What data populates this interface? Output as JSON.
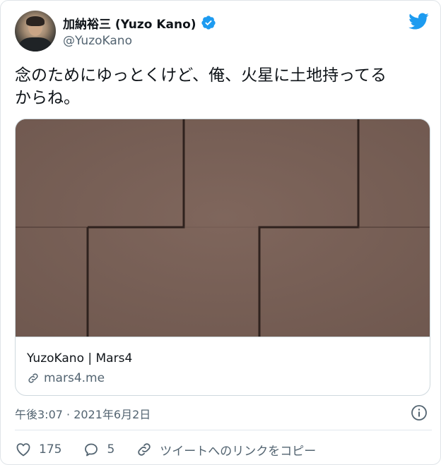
{
  "author": {
    "display_name": "加納裕三 (Yuzo Kano)",
    "handle": "@YuzoKano",
    "verified": true
  },
  "tweet": {
    "text_line1": "念のためにゆっとくけど、俺、火星に土地持ってる",
    "text_line2": "からね。"
  },
  "card": {
    "title": "YuzoKano | Mars4",
    "domain": "mars4.me"
  },
  "timestamp": "午後3:07 · 2021年6月2日",
  "actions": {
    "likes": "175",
    "replies": "5",
    "copy_link_label": "ツイートへのリンクをコピー"
  },
  "colors": {
    "brand": "#1d9bf0",
    "secondary_text": "#536471",
    "mars_surface": "#7a6158"
  },
  "icons": [
    "verified-badge-icon",
    "twitter-bird-icon",
    "link-icon",
    "info-icon",
    "heart-icon",
    "reply-icon",
    "copy-link-icon"
  ]
}
